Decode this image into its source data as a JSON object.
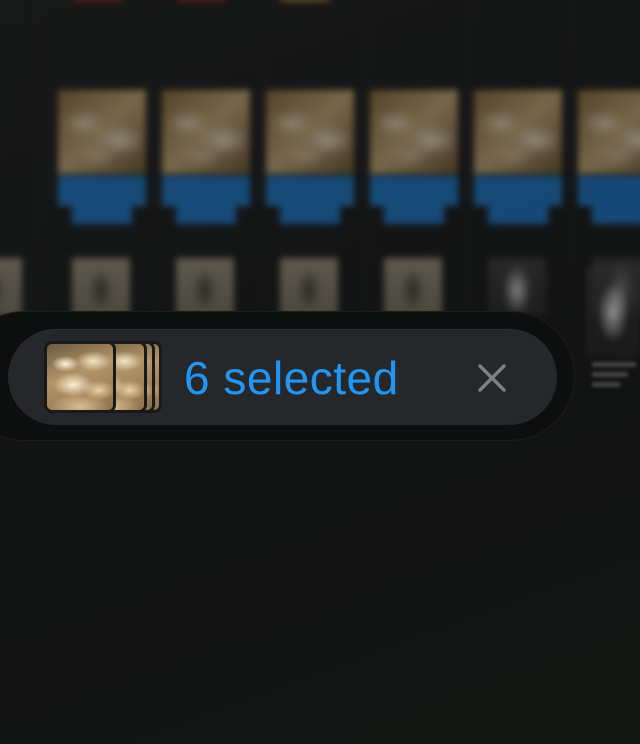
{
  "selection_bar": {
    "count_label": "6 selected",
    "accent_color": "#2196f3",
    "thumbnail_icon": "image-stack-icon",
    "close_icon": "close-icon"
  }
}
